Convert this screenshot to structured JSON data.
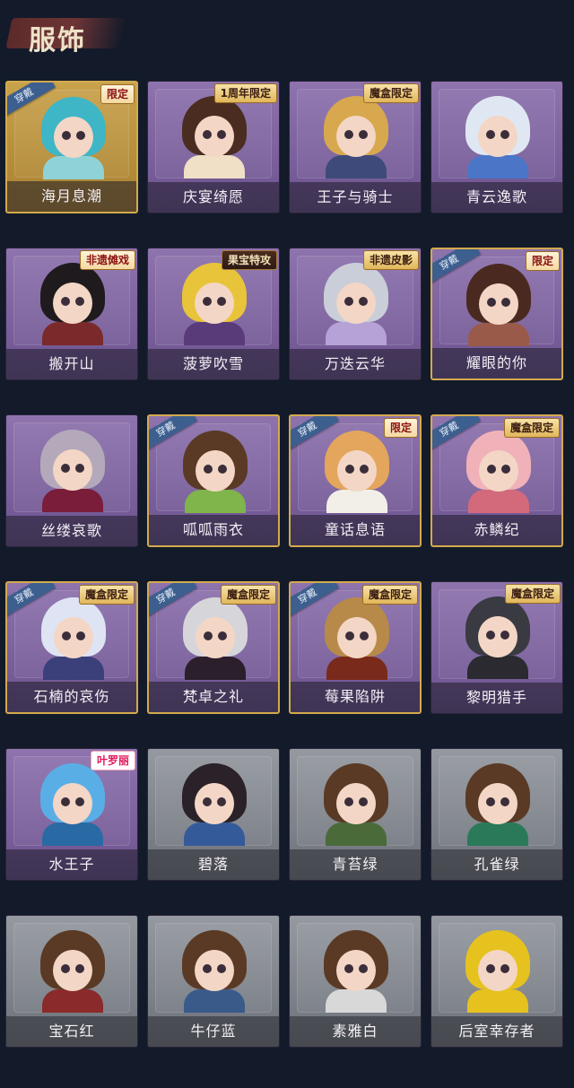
{
  "header": {
    "title": "服饰"
  },
  "equip_badge_text": "穿戴",
  "items": [
    {
      "name": "海月息潮",
      "tag": "限定",
      "tagStyle": "red",
      "equipped": true,
      "theme": "gold",
      "hair": "#3fb6c6",
      "cloth": "#8fd2d8"
    },
    {
      "name": "庆宴绮愿",
      "tag": "1周年限定",
      "tagStyle": "gold",
      "equipped": false,
      "theme": "purple",
      "hair": "#4a2d20",
      "cloth": "#f0e1c6"
    },
    {
      "name": "王子与骑士",
      "tag": "魔盒限定",
      "tagStyle": "gold",
      "equipped": false,
      "theme": "purple",
      "hair": "#d8a84f",
      "cloth": "#3e4b7a"
    },
    {
      "name": "青云逸歌",
      "tag": "",
      "tagStyle": "",
      "equipped": false,
      "theme": "purple",
      "hair": "#dfe8f2",
      "cloth": "#4b76c8"
    },
    {
      "name": "搬开山",
      "tag": "非遗傩戏",
      "tagStyle": "red",
      "equipped": false,
      "theme": "purple",
      "hair": "#1f1a1d",
      "cloth": "#7a2a2a"
    },
    {
      "name": "菠萝吹雪",
      "tag": "果宝特攻",
      "tagStyle": "dark",
      "equipped": false,
      "theme": "purple",
      "hair": "#e8c43a",
      "cloth": "#5a3b7a"
    },
    {
      "name": "万迭云华",
      "tag": "非遗皮影",
      "tagStyle": "gold",
      "equipped": false,
      "theme": "purple",
      "hair": "#c9ced8",
      "cloth": "#b6a2d6"
    },
    {
      "name": "耀眼的你",
      "tag": "限定",
      "tagStyle": "red",
      "equipped": true,
      "theme": "purple",
      "hair": "#4a2a20",
      "cloth": "#9a5a4a"
    },
    {
      "name": "丝缕哀歌",
      "tag": "",
      "tagStyle": "",
      "equipped": false,
      "theme": "purple",
      "hair": "#b4a9ba",
      "cloth": "#7a1d3a"
    },
    {
      "name": "呱呱雨衣",
      "tag": "",
      "tagStyle": "",
      "equipped": true,
      "theme": "purple",
      "hair": "#5a3a25",
      "cloth": "#7fb54a"
    },
    {
      "name": "童话息语",
      "tag": "限定",
      "tagStyle": "red",
      "equipped": true,
      "theme": "purple",
      "hair": "#e4a65c",
      "cloth": "#f2efe8"
    },
    {
      "name": "赤鳞纪",
      "tag": "魔盒限定",
      "tagStyle": "gold",
      "equipped": true,
      "theme": "purple",
      "hair": "#f0b2b8",
      "cloth": "#d36a7c"
    },
    {
      "name": "石楠的哀伤",
      "tag": "魔盒限定",
      "tagStyle": "gold",
      "equipped": true,
      "theme": "purple",
      "hair": "#dfe4f4",
      "cloth": "#3b3f7a"
    },
    {
      "name": "梵卓之礼",
      "tag": "魔盒限定",
      "tagStyle": "gold",
      "equipped": true,
      "theme": "purple",
      "hair": "#d6d6da",
      "cloth": "#2a1f2a"
    },
    {
      "name": "莓果陷阱",
      "tag": "魔盒限定",
      "tagStyle": "gold",
      "equipped": true,
      "theme": "purple",
      "hair": "#b78a4a",
      "cloth": "#7a2a1a"
    },
    {
      "name": "黎明猎手",
      "tag": "魔盒限定",
      "tagStyle": "gold",
      "equipped": false,
      "theme": "purple",
      "hair": "#3a3a42",
      "cloth": "#2a2a30"
    },
    {
      "name": "水王子",
      "tag": "叶罗丽",
      "tagStyle": "pink",
      "equipped": false,
      "theme": "purple",
      "hair": "#5aaee6",
      "cloth": "#2a6aa4"
    },
    {
      "name": "碧落",
      "tag": "",
      "tagStyle": "",
      "equipped": false,
      "theme": "gray",
      "hair": "#2a2228",
      "cloth": "#355a9a"
    },
    {
      "name": "青苔绿",
      "tag": "",
      "tagStyle": "",
      "equipped": false,
      "theme": "gray",
      "hair": "#5a3a25",
      "cloth": "#4a6a3a"
    },
    {
      "name": "孔雀绿",
      "tag": "",
      "tagStyle": "",
      "equipped": false,
      "theme": "gray",
      "hair": "#5a3a25",
      "cloth": "#2a7a5a"
    },
    {
      "name": "宝石红",
      "tag": "",
      "tagStyle": "",
      "equipped": false,
      "theme": "gray",
      "hair": "#5a3a25",
      "cloth": "#8a2a2a"
    },
    {
      "name": "牛仔蓝",
      "tag": "",
      "tagStyle": "",
      "equipped": false,
      "theme": "gray",
      "hair": "#5a3a25",
      "cloth": "#3a5a8a"
    },
    {
      "name": "素雅白",
      "tag": "",
      "tagStyle": "",
      "equipped": false,
      "theme": "gray",
      "hair": "#5a3a25",
      "cloth": "#d8d8d8"
    },
    {
      "name": "后室幸存者",
      "tag": "",
      "tagStyle": "",
      "equipped": false,
      "theme": "gray",
      "hair": "#e6c21f",
      "cloth": "#e6c21f"
    }
  ]
}
